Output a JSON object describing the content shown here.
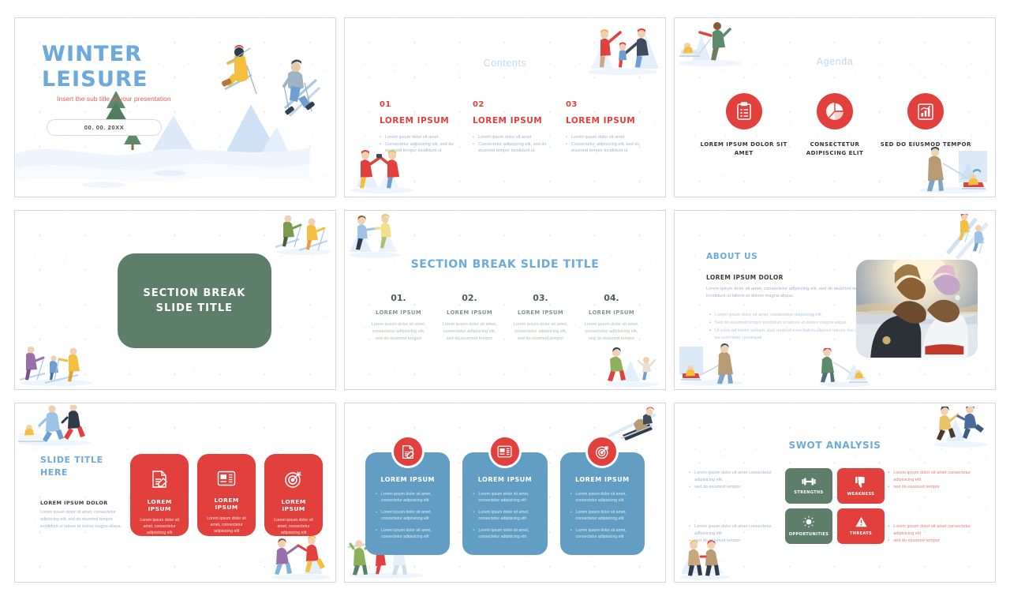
{
  "deck": {
    "slides": [
      {
        "id": "title-slide",
        "title_line1": "WINTER",
        "title_line2": "LEISURE",
        "subtitle": "Insert the sub title of your presentation",
        "date": "00. 00. 20XX"
      },
      {
        "id": "contents-slide",
        "title": "Contents",
        "columns": [
          {
            "number": "01",
            "heading": "LOREM IPSUM",
            "bullets": [
              "Lorem ipsum dolor sit amet",
              "Consectetur adipisicing elit, sed do eiusmod tempor incididunt ut"
            ]
          },
          {
            "number": "02",
            "heading": "LOREM IPSUM",
            "bullets": [
              "Lorem ipsum dolor sit amet",
              "Consectetur adipisicing elit, sed do eiusmod tempor incididunt ut"
            ]
          },
          {
            "number": "03",
            "heading": "LOREM IPSUM",
            "bullets": [
              "Lorem ipsum dolor sit amet",
              "Consectetur adipisicing elit, sed do eiusmod tempor incididunt ut"
            ]
          }
        ]
      },
      {
        "id": "agenda-slide",
        "title": "Agenda",
        "items": [
          {
            "icon": "clipboard-checklist-icon",
            "label": "LOREM IPSUM DOLOR SIT AMET"
          },
          {
            "icon": "pie-chart-icon",
            "label": "CONSECTETUR ADIPISCING ELIT"
          },
          {
            "icon": "bar-chart-growth-icon",
            "label": "SED DO EIUSMOD TEMPOR"
          }
        ]
      },
      {
        "id": "section-break-slide",
        "box_line1": "SECTION BREAK",
        "box_line2": "SLIDE TITLE",
        "box_color": "#5d7e68"
      },
      {
        "id": "section-break-steps-slide",
        "title": "SECTION BREAK SLIDE TITLE",
        "columns": [
          {
            "number": "01.",
            "heading": "LOREM IPSUM",
            "body": "Lorem ipsum dolor sit amet, consectetur adipisicing elit, sed do eiusmod tempor"
          },
          {
            "number": "02.",
            "heading": "LOREM IPSUM",
            "body": "Lorem ipsum dolor sit amet, consectetur adipisicing elit, sed do eiusmod tempor"
          },
          {
            "number": "03.",
            "heading": "LOREM IPSUM",
            "body": "Lorem ipsum dolor sit amet, consectetur adipisicing elit, sed do eiusmod tempor"
          },
          {
            "number": "04.",
            "heading": "LOREM IPSUM",
            "body": "Lorem ipsum dolor sit amet, consectetur adipisicing elit, sed do eiusmod tempor"
          }
        ]
      },
      {
        "id": "about-us-slide",
        "title": "ABOUT US",
        "heading": "LOREM IPSUM DOLOR",
        "paragraph": "Lorem ipsum dolor sit amet, consectetur adipiscing elit, sed do eiusmod tempor incididunt ut labore et dolore magna aliqua.",
        "bullets": [
          "Lorem ipsum dolor sit amet, consectetur adipiscing elit",
          "Sed do eiusmod tempor incididunt ut labore et dolore magna aliqua",
          "Ut enim ad minim veniam, quis nostrud exercitation ullamco laboris nisi ut aliquip ex ea commodo consequat"
        ]
      },
      {
        "id": "red-cards-slide",
        "title_line1": "SLIDE TITLE",
        "title_line2": "HERE",
        "heading": "LOREM IPSUM DOLOR",
        "paragraph": "Lorem ipsum dolor sit amet, consectetur adipiscing elit, sed do eiusmod tempor incididunt ut labore et dolore magna aliqua.",
        "cards": [
          {
            "icon": "document-edit-icon",
            "title": "LOREM IPSUM",
            "body": "Lorem ipsum dolor sit amet, consectetur adipisicing elit"
          },
          {
            "icon": "layout-article-icon",
            "title": "LOREM IPSUM",
            "body": "Lorem ipsum dolor sit amet, consectetur adipisicing elit"
          },
          {
            "icon": "target-icon",
            "title": "LOREM IPSUM",
            "body": "Lorem ipsum dolor sit amet, consectetur adipisicing elit"
          }
        ]
      },
      {
        "id": "blue-cards-slide",
        "cards": [
          {
            "icon": "document-edit-icon",
            "title": "LOREM IPSUM",
            "bullets": [
              "Lorem ipsum dolor sit amet, consectetur adipisicing elit",
              "Lorem ipsum dolor sit amet, consectetur adipisicing elit",
              "Lorem ipsum dolor sit amet, consectetur adipisicing elit"
            ]
          },
          {
            "icon": "layout-article-icon",
            "title": "LOREM IPSUM",
            "bullets": [
              "Lorem ipsum dolor sit amet, consectetur adipisicing elit",
              "Lorem ipsum dolor sit amet, consectetur adipisicing elit",
              "Lorem ipsum dolor sit amet, consectetur adipisicing elit"
            ]
          },
          {
            "icon": "target-icon",
            "title": "LOREM IPSUM",
            "bullets": [
              "Lorem ipsum dolor sit amet, consectetur adipisicing elit",
              "Lorem ipsum dolor sit amet, consectetur adipisicing elit",
              "Lorem ipsum dolor sit amet, consectetur adipisicing elit"
            ]
          }
        ]
      },
      {
        "id": "swot-slide",
        "title": "SWOT ANALYSIS",
        "boxes": [
          {
            "icon": "dumbbell-icon",
            "label": "STRENGTHS",
            "color": "#5d7e68"
          },
          {
            "icon": "thumbs-down-icon",
            "label": "WEAKNESS",
            "color": "#e2403c"
          },
          {
            "icon": "lightbulb-icon",
            "label": "OPPORTUNITIES",
            "color": "#5d7e68"
          },
          {
            "icon": "warning-triangle-icon",
            "label": "THREATS",
            "color": "#e2403c"
          }
        ],
        "left_top": [
          "Lorem ipsum dolor sit amet consectetur adipisicing elit",
          "sed do eiusmod tempor"
        ],
        "left_bottom": [
          "Lorem ipsum dolor sit amet consectetur adipisicing elit",
          "sed do eiusmod tempor"
        ],
        "right_top": [
          "Lorem ipsum dolor sit amet consectetur adipisicing elit",
          "sed do eiusmod tempor"
        ],
        "right_bottom": [
          "Lorem ipsum dolor sit amet consectetur adipisicing elit",
          "sed do eiusmod tempor"
        ]
      }
    ]
  },
  "colors": {
    "accent_red": "#e2403c",
    "accent_blue": "#6ca9dd",
    "accent_green": "#5d7e68",
    "card_blue": "#629ec4",
    "muted_text": "#9fb6cc"
  }
}
